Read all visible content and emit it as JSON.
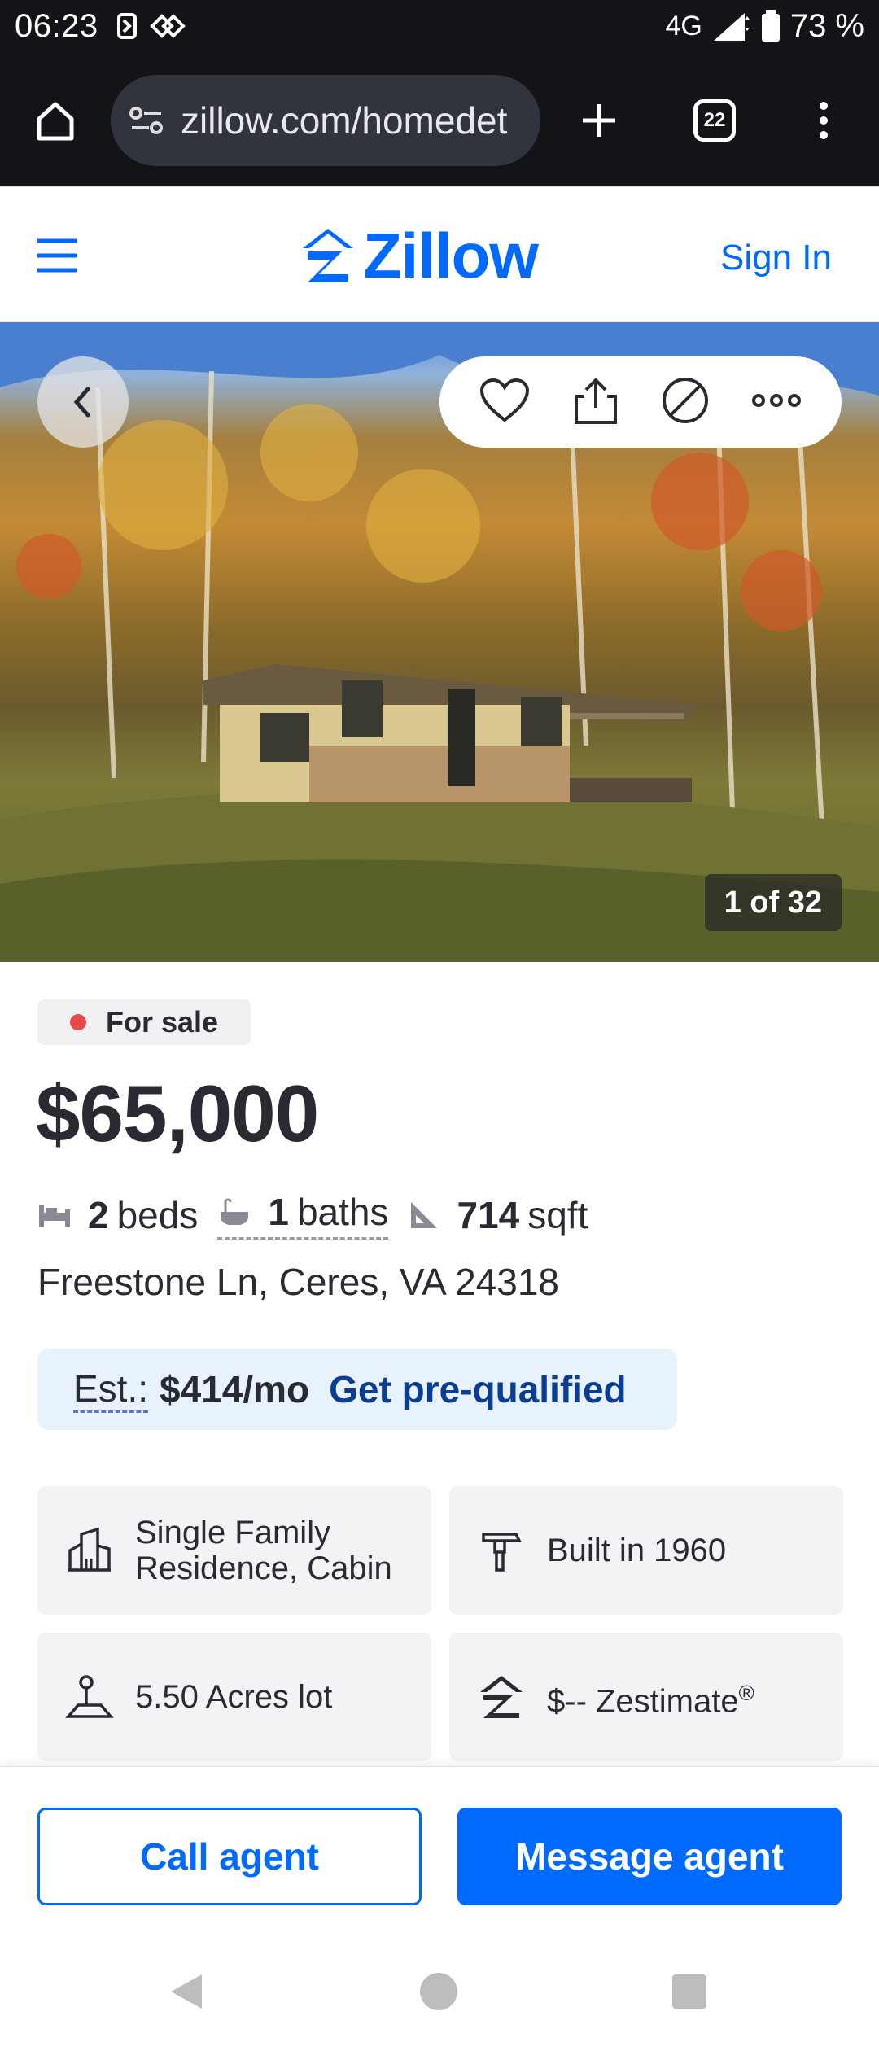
{
  "status_bar": {
    "time": "06:23",
    "network": "4G",
    "battery": "73 %"
  },
  "browser": {
    "url": "zillow.com/homedet",
    "tab_count": "22"
  },
  "header": {
    "logo": "Zillow",
    "sign_in": "Sign In"
  },
  "gallery": {
    "counter": "1 of 32"
  },
  "listing": {
    "status": "For sale",
    "price": "$65,000",
    "beds_value": "2",
    "beds_label": "beds",
    "baths_value": "1",
    "baths_label": "baths",
    "sqft_value": "714",
    "sqft_label": "sqft",
    "address": "Freestone Ln, Ceres, VA 24318",
    "estimate_label": "Est.:",
    "estimate_value": "$414/mo",
    "prequalify": "Get pre-qualified"
  },
  "facts": {
    "type_line1": "Single Family",
    "type_line2": "Residence, Cabin",
    "built": "Built in 1960",
    "lot": "5.50 Acres lot",
    "zestimate": "$-- Zestimate",
    "zestimate_mark": "®"
  },
  "actions": {
    "call": "Call agent",
    "message": "Message agent"
  },
  "colors": {
    "brand": "#006aff",
    "status_dot": "#e84a4a",
    "estimate_bg": "#e7f2fd"
  }
}
